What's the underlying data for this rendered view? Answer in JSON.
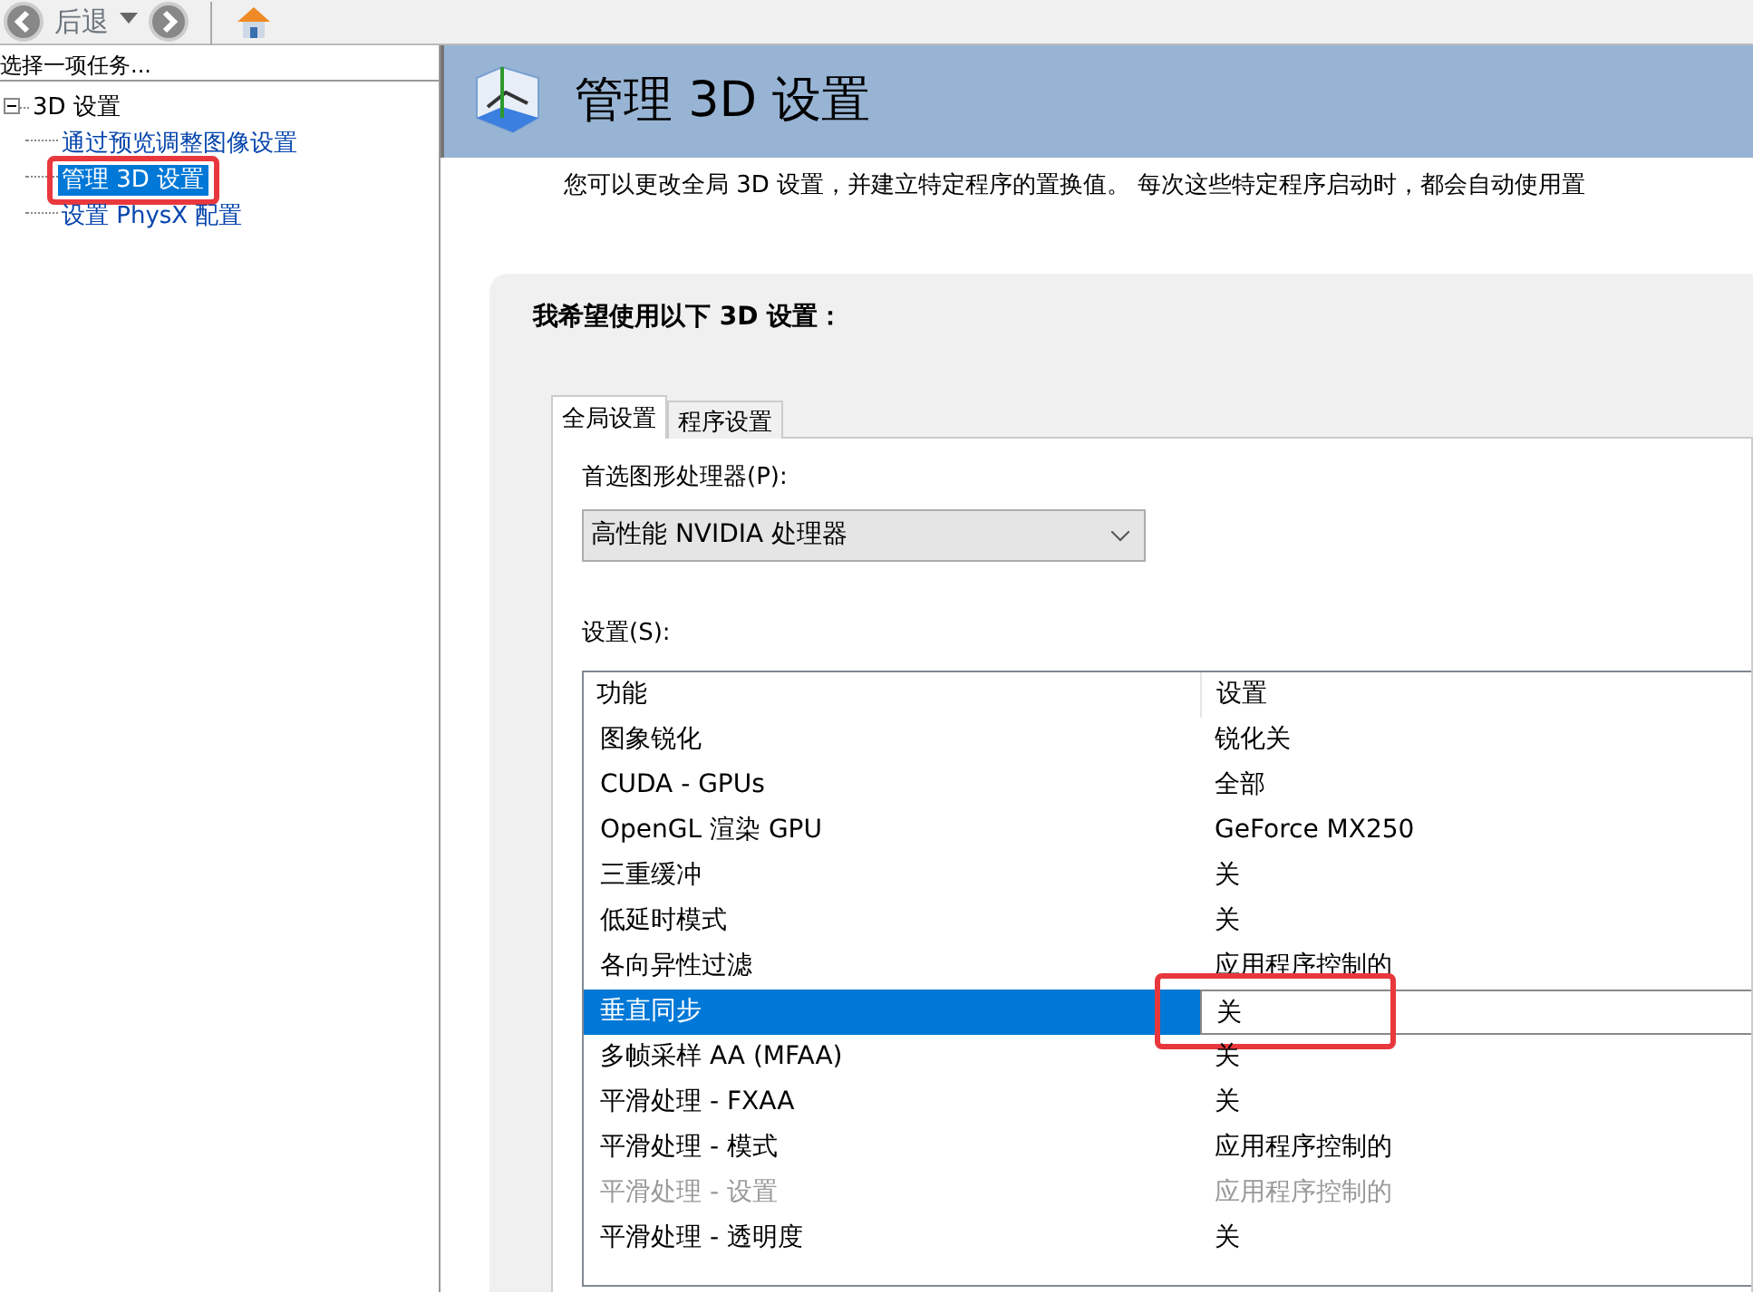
{
  "toolbar": {
    "back_label": "后退"
  },
  "task_panel": {
    "title": "选择一项任务...",
    "tree": [
      {
        "label": "3D 设置",
        "expanded": true,
        "selected": false,
        "annotated": false,
        "children": [
          {
            "label": "通过预览调整图像设置",
            "selected": false,
            "annotated": false
          },
          {
            "label": "管理 3D 设置",
            "selected": true,
            "annotated": true
          },
          {
            "label": "设置 PhysX 配置",
            "selected": false,
            "annotated": false
          }
        ]
      }
    ]
  },
  "page": {
    "title": "管理 3D 设置",
    "description": "您可以更改全局 3D 设置，并建立特定程序的置换值。 每次这些特定程序启动时，都会自动使用置"
  },
  "settings_panel": {
    "heading": "我希望使用以下 3D 设置：",
    "tabs": [
      {
        "label": "全局设置",
        "selected": true
      },
      {
        "label": "程序设置",
        "selected": false
      }
    ],
    "gpu_label": "首选图形处理器(P):",
    "gpu_value": "高性能 NVIDIA 处理器",
    "settings_label": "设置(S):",
    "table": {
      "columns": [
        "功能",
        "设置"
      ],
      "rows": [
        {
          "feature": "图象锐化",
          "value": "锐化关",
          "selected": false,
          "disabled": false,
          "annotated": false
        },
        {
          "feature": "CUDA - GPUs",
          "value": "全部",
          "selected": false,
          "disabled": false,
          "annotated": false
        },
        {
          "feature": "OpenGL 渲染 GPU",
          "value": "GeForce MX250",
          "selected": false,
          "disabled": false,
          "annotated": false
        },
        {
          "feature": "三重缓冲",
          "value": "关",
          "selected": false,
          "disabled": false,
          "annotated": false
        },
        {
          "feature": "低延时模式",
          "value": "关",
          "selected": false,
          "disabled": false,
          "annotated": false
        },
        {
          "feature": "各向异性过滤",
          "value": "应用程序控制的",
          "selected": false,
          "disabled": false,
          "annotated": false
        },
        {
          "feature": "垂直同步",
          "value": "关",
          "selected": true,
          "disabled": false,
          "annotated": true
        },
        {
          "feature": "多帧采样 AA (MFAA)",
          "value": "关",
          "selected": false,
          "disabled": false,
          "annotated": false
        },
        {
          "feature": "平滑处理 - FXAA",
          "value": "关",
          "selected": false,
          "disabled": false,
          "annotated": false
        },
        {
          "feature": "平滑处理 - 模式",
          "value": "应用程序控制的",
          "selected": false,
          "disabled": false,
          "annotated": false
        },
        {
          "feature": "平滑处理 - 设置",
          "value": "应用程序控制的",
          "selected": false,
          "disabled": true,
          "annotated": false
        },
        {
          "feature": "平滑处理 - 透明度",
          "value": "关",
          "selected": false,
          "disabled": false,
          "annotated": false
        }
      ]
    }
  }
}
